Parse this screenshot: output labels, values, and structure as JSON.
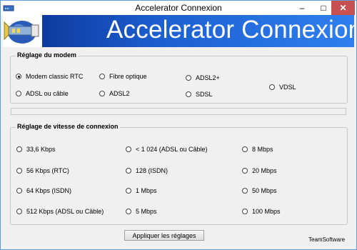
{
  "window": {
    "title": "Accelerator Connexion",
    "controls": {
      "minimize": "–",
      "maximize": "□",
      "close": "✕"
    }
  },
  "banner": {
    "title": "Accelerator Connexion"
  },
  "modem_group": {
    "legend": "Réglage du modem",
    "options": [
      {
        "label": "Modem classic RTC",
        "checked": true
      },
      {
        "label": "Fibre optique",
        "checked": false
      },
      {
        "label": "ADSL2+",
        "checked": false
      },
      {
        "label": "VDSL",
        "checked": false
      },
      {
        "label": "ADSL ou câble",
        "checked": false
      },
      {
        "label": "ADSL2",
        "checked": false
      },
      {
        "label": "SDSL",
        "checked": false
      }
    ]
  },
  "speed_group": {
    "legend": "Réglage de vitesse de connexion",
    "options": [
      {
        "label": "33,6 Kbps"
      },
      {
        "label": "56 Kbps (RTC)"
      },
      {
        "label": "64 Kbps (ISDN)"
      },
      {
        "label": "512 Kbps (ADSL ou Câble)"
      },
      {
        "label": "< 1 024 (ADSL ou Câble)"
      },
      {
        "label": "128 (ISDN)"
      },
      {
        "label": "1 Mbps"
      },
      {
        "label": "5 Mbps"
      },
      {
        "label": "8 Mbps"
      },
      {
        "label": "20 Mbps"
      },
      {
        "label": "50 Mbps"
      },
      {
        "label": "100 Mbps"
      }
    ]
  },
  "actions": {
    "apply_label": "Appliquer les réglages"
  },
  "footer": {
    "brand": "TeamSoftware"
  },
  "colors": {
    "banner_dark": "#0a2e8e",
    "banner_light": "#2f7ff0",
    "close_button": "#c75050",
    "window_border": "#5aa0e0"
  },
  "icons": {
    "app": "modem-icon",
    "banner": "network-plug-icon"
  }
}
